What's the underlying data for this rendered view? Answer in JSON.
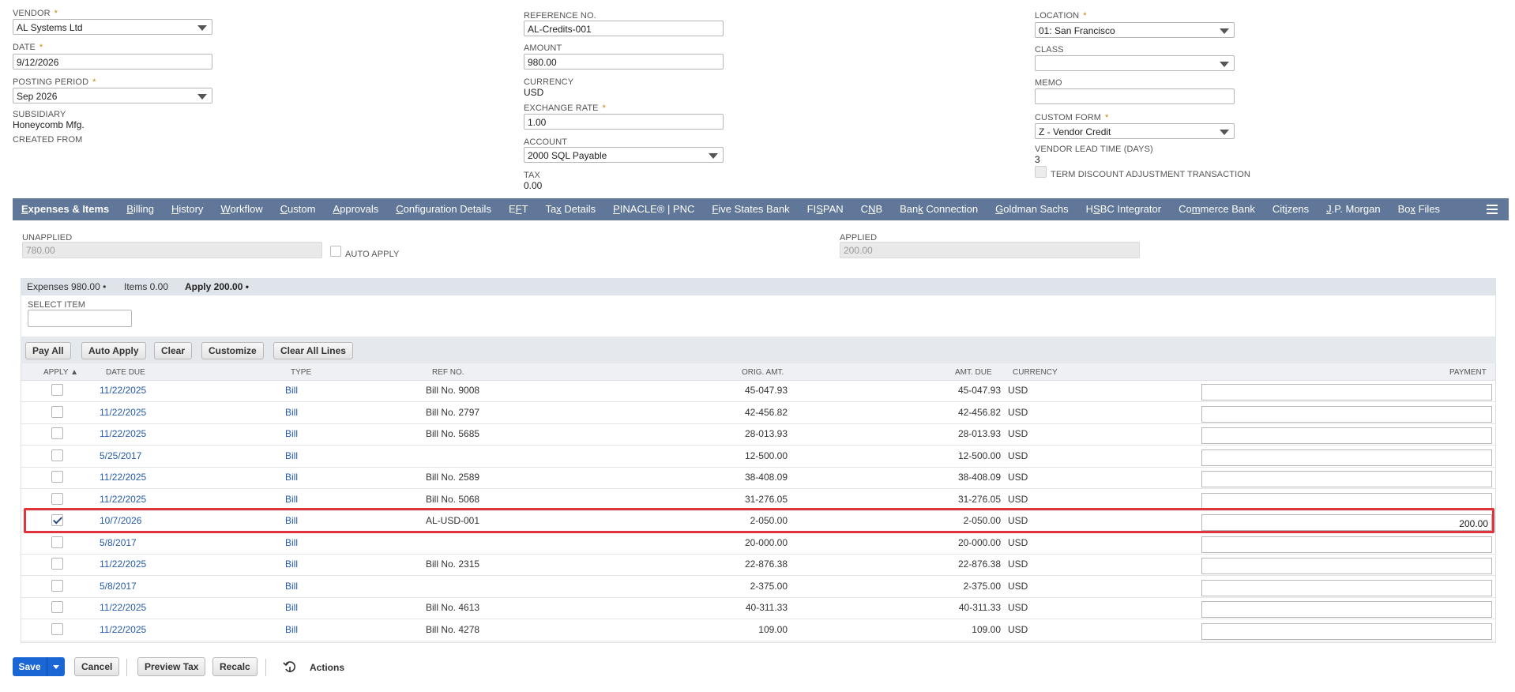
{
  "header": {
    "vendor": {
      "label": "VENDOR",
      "value": "AL Systems Ltd"
    },
    "date": {
      "label": "DATE",
      "value": "9/12/2026"
    },
    "posting_period": {
      "label": "POSTING PERIOD",
      "value": "Sep 2026"
    },
    "subsidiary": {
      "label": "SUBSIDIARY",
      "value": "Honeycomb Mfg."
    },
    "created_from": {
      "label": "CREATED FROM"
    },
    "reference_no": {
      "label": "REFERENCE NO.",
      "value": "AL-Credits-001"
    },
    "amount": {
      "label": "AMOUNT",
      "value": "980.00"
    },
    "currency": {
      "label": "CURRENCY",
      "value": "USD"
    },
    "exchange_rate": {
      "label": "EXCHANGE RATE",
      "value": "1.00"
    },
    "account": {
      "label": "ACCOUNT",
      "value": "2000 SQL Payable"
    },
    "tax": {
      "label": "TAX",
      "value": "0.00"
    },
    "location": {
      "label": "LOCATION",
      "value": "01: San Francisco"
    },
    "class": {
      "label": "CLASS",
      "value": ""
    },
    "memo": {
      "label": "MEMO",
      "value": ""
    },
    "custom_form": {
      "label": "CUSTOM FORM",
      "value": "Z - Vendor Credit"
    },
    "vendor_lead_time": {
      "label": "VENDOR LEAD TIME (DAYS)",
      "value": "3"
    },
    "term_discount": {
      "label": "TERM DISCOUNT ADJUSTMENT TRANSACTION"
    },
    "required_mark": "*"
  },
  "tabs": [
    {
      "pre": "",
      "u": "E",
      "post": "xpenses & Items"
    },
    {
      "pre": "",
      "u": "B",
      "post": "illing"
    },
    {
      "pre": "",
      "u": "H",
      "post": "istory"
    },
    {
      "pre": "",
      "u": "W",
      "post": "orkflow"
    },
    {
      "pre": "",
      "u": "C",
      "post": "ustom"
    },
    {
      "pre": "",
      "u": "A",
      "post": "pprovals"
    },
    {
      "pre": "",
      "u": "C",
      "post": "onfiguration Details"
    },
    {
      "pre": "E",
      "u": "F",
      "post": "T"
    },
    {
      "pre": "Ta",
      "u": "x",
      "post": " Details"
    },
    {
      "pre": "",
      "u": "P",
      "post": "INACLE® | PNC"
    },
    {
      "pre": "",
      "u": "F",
      "post": "ive States Bank"
    },
    {
      "pre": "FI",
      "u": "S",
      "post": "PAN"
    },
    {
      "pre": "C",
      "u": "N",
      "post": "B"
    },
    {
      "pre": "Ban",
      "u": "k",
      "post": " Connection"
    },
    {
      "pre": "",
      "u": "G",
      "post": "oldman Sachs"
    },
    {
      "pre": "H",
      "u": "S",
      "post": "BC Integrator"
    },
    {
      "pre": "Co",
      "u": "m",
      "post": "merce Bank"
    },
    {
      "pre": "Cit",
      "u": "i",
      "post": "zens"
    },
    {
      "pre": "",
      "u": "J",
      "post": ".P. Morgan"
    },
    {
      "pre": "Bo",
      "u": "x",
      "post": " Files"
    }
  ],
  "apply_section": {
    "unapplied": {
      "label": "UNAPPLIED",
      "value": "780.00"
    },
    "auto_apply": {
      "label": "AUTO APPLY"
    },
    "applied": {
      "label": "APPLIED",
      "value": "200.00"
    }
  },
  "subtabs": {
    "expenses": "Expenses 980.00 •",
    "items": "Items 0.00",
    "apply": "Apply 200.00 •"
  },
  "select_item": {
    "label": "SELECT ITEM"
  },
  "buttons": {
    "pay_all": "Pay All",
    "auto_apply": "Auto Apply",
    "clear": "Clear",
    "customize": "Customize",
    "clear_all_lines": "Clear All Lines"
  },
  "columns": {
    "apply": "APPLY ▲",
    "date_due": "DATE DUE",
    "type": "TYPE",
    "ref_no": "REF NO.",
    "orig_amt": "ORIG. AMT.",
    "amt_due": "AMT. DUE",
    "currency": "CURRENCY",
    "payment": "PAYMENT"
  },
  "rows": [
    {
      "checked": false,
      "date_due": "11/22/2025",
      "type": "Bill",
      "ref_no": "Bill No. 9008",
      "orig_amt": "45-047.93",
      "amt_due": "45-047.93",
      "currency": "USD",
      "payment": ""
    },
    {
      "checked": false,
      "date_due": "11/22/2025",
      "type": "Bill",
      "ref_no": "Bill No. 2797",
      "orig_amt": "42-456.82",
      "amt_due": "42-456.82",
      "currency": "USD",
      "payment": ""
    },
    {
      "checked": false,
      "date_due": "11/22/2025",
      "type": "Bill",
      "ref_no": "Bill No. 5685",
      "orig_amt": "28-013.93",
      "amt_due": "28-013.93",
      "currency": "USD",
      "payment": ""
    },
    {
      "checked": false,
      "date_due": "5/25/2017",
      "type": "Bill",
      "ref_no": "",
      "orig_amt": "12-500.00",
      "amt_due": "12-500.00",
      "currency": "USD",
      "payment": ""
    },
    {
      "checked": false,
      "date_due": "11/22/2025",
      "type": "Bill",
      "ref_no": "Bill No. 2589",
      "orig_amt": "38-408.09",
      "amt_due": "38-408.09",
      "currency": "USD",
      "payment": ""
    },
    {
      "checked": false,
      "date_due": "11/22/2025",
      "type": "Bill",
      "ref_no": "Bill No. 5068",
      "orig_amt": "31-276.05",
      "amt_due": "31-276.05",
      "currency": "USD",
      "payment": ""
    },
    {
      "checked": true,
      "date_due": "10/7/2026",
      "type": "Bill",
      "ref_no": "AL-USD-001",
      "orig_amt": "2-050.00",
      "amt_due": "2-050.00",
      "currency": "USD",
      "payment": "200.00"
    },
    {
      "checked": false,
      "date_due": "5/8/2017",
      "type": "Bill",
      "ref_no": "",
      "orig_amt": "20-000.00",
      "amt_due": "20-000.00",
      "currency": "USD",
      "payment": ""
    },
    {
      "checked": false,
      "date_due": "11/22/2025",
      "type": "Bill",
      "ref_no": "Bill No. 2315",
      "orig_amt": "22-876.38",
      "amt_due": "22-876.38",
      "currency": "USD",
      "payment": ""
    },
    {
      "checked": false,
      "date_due": "5/8/2017",
      "type": "Bill",
      "ref_no": "",
      "orig_amt": "2-375.00",
      "amt_due": "2-375.00",
      "currency": "USD",
      "payment": ""
    },
    {
      "checked": false,
      "date_due": "11/22/2025",
      "type": "Bill",
      "ref_no": "Bill No. 4613",
      "orig_amt": "40-311.33",
      "amt_due": "40-311.33",
      "currency": "USD",
      "payment": ""
    },
    {
      "checked": false,
      "date_due": "11/22/2025",
      "type": "Bill",
      "ref_no": "Bill No. 4278",
      "orig_amt": "109.00",
      "amt_due": "109.00",
      "currency": "USD",
      "payment": ""
    }
  ],
  "footer": {
    "save": "Save",
    "cancel": "Cancel",
    "preview_tax": "Preview Tax",
    "recalc": "Recalc",
    "actions": "Actions"
  },
  "colors": {
    "tab_bar": "#607799",
    "save_button": "#1a66d4",
    "highlight": "#e0343c",
    "link": "#255ba8"
  }
}
